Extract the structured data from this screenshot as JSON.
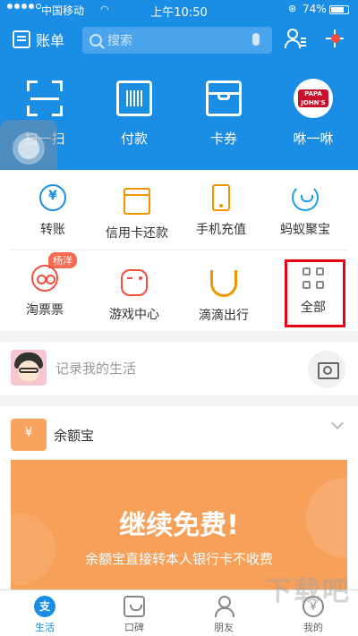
{
  "status_bar": {
    "carrier": "中国移动",
    "time": "上午10:50",
    "battery": "74%"
  },
  "header": {
    "bill_label": "账单",
    "search_placeholder": "搜索"
  },
  "quick_actions": [
    {
      "label": "扫一扫",
      "icon": "scan-icon"
    },
    {
      "label": "付款",
      "icon": "barcode-icon"
    },
    {
      "label": "卡券",
      "icon": "card-icon"
    },
    {
      "label": "咻一咻",
      "icon": "pizza-logo-icon",
      "logo_text": "PAPA JOHN'S"
    }
  ],
  "grid": {
    "row1": [
      {
        "label": "转账",
        "icon": "transfer-icon"
      },
      {
        "label": "信用卡还款",
        "icon": "credit-card-icon"
      },
      {
        "label": "手机充值",
        "icon": "phone-icon"
      },
      {
        "label": "蚂蚁聚宝",
        "icon": "fund-icon"
      }
    ],
    "row2": [
      {
        "label": "淘票票",
        "icon": "ticket-icon",
        "badge": "杨洋"
      },
      {
        "label": "游戏中心",
        "icon": "gamepad-icon"
      },
      {
        "label": "滴滴出行",
        "icon": "didi-icon"
      },
      {
        "label": "全部",
        "icon": "grid-icon"
      }
    ]
  },
  "life": {
    "prompt": "记录我的生活"
  },
  "yeb": {
    "title": "余额宝",
    "banner_title": "继续免费!",
    "banner_subtitle": "余额宝直接转本人银行卡不收费"
  },
  "tabbar": [
    {
      "label": "生活",
      "icon": "life-icon",
      "active": true,
      "glyph": "支"
    },
    {
      "label": "口碑",
      "icon": "koubei-icon",
      "active": false
    },
    {
      "label": "朋友",
      "icon": "friends-icon",
      "active": false
    },
    {
      "label": "我的",
      "icon": "mine-icon",
      "active": false,
      "glyph": "¥"
    }
  ],
  "colors": {
    "primary": "#1a8de5",
    "orange": "#f29400",
    "red": "#f24e3e",
    "banner": "#f7a05a",
    "highlight": "#e50012"
  }
}
